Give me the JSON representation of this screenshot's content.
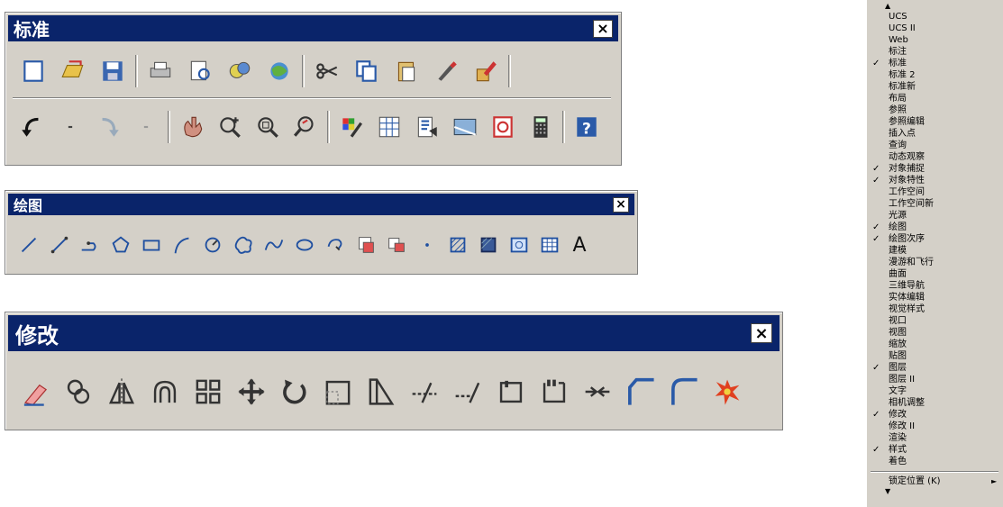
{
  "standard": {
    "title": "标准",
    "close": "×"
  },
  "draw": {
    "title": "绘图",
    "close": "×",
    "text_tool": "A"
  },
  "modify": {
    "title": "修改",
    "close": "×"
  },
  "menu": {
    "scroll_up": "▲",
    "scroll_down": "▼",
    "items": [
      {
        "label": "UCS",
        "checked": false
      },
      {
        "label": "UCS II",
        "checked": false
      },
      {
        "label": "Web",
        "checked": false
      },
      {
        "label": "标注",
        "checked": false
      },
      {
        "label": "标准",
        "checked": true
      },
      {
        "label": "标准 2",
        "checked": false
      },
      {
        "label": "标准新",
        "checked": false
      },
      {
        "label": "布局",
        "checked": false
      },
      {
        "label": "参照",
        "checked": false
      },
      {
        "label": "参照编辑",
        "checked": false
      },
      {
        "label": "插入点",
        "checked": false
      },
      {
        "label": "查询",
        "checked": false
      },
      {
        "label": "动态观察",
        "checked": false
      },
      {
        "label": "对象捕捉",
        "checked": true
      },
      {
        "label": "对象特性",
        "checked": true
      },
      {
        "label": "工作空间",
        "checked": false
      },
      {
        "label": "工作空间新",
        "checked": false
      },
      {
        "label": "光源",
        "checked": false
      },
      {
        "label": "绘图",
        "checked": true
      },
      {
        "label": "绘图次序",
        "checked": true
      },
      {
        "label": "建模",
        "checked": false
      },
      {
        "label": "漫游和飞行",
        "checked": false
      },
      {
        "label": "曲面",
        "checked": false
      },
      {
        "label": "三维导航",
        "checked": false
      },
      {
        "label": "实体编辑",
        "checked": false
      },
      {
        "label": "视觉样式",
        "checked": false
      },
      {
        "label": "视口",
        "checked": false
      },
      {
        "label": "视图",
        "checked": false
      },
      {
        "label": "缩放",
        "checked": false
      },
      {
        "label": "贴图",
        "checked": false
      },
      {
        "label": "图层",
        "checked": true
      },
      {
        "label": "图层 II",
        "checked": false
      },
      {
        "label": "文字",
        "checked": false
      },
      {
        "label": "相机调整",
        "checked": false
      },
      {
        "label": "修改",
        "checked": true
      },
      {
        "label": "修改 II",
        "checked": false
      },
      {
        "label": "渲染",
        "checked": false
      },
      {
        "label": "样式",
        "checked": true
      },
      {
        "label": "着色",
        "checked": false
      }
    ],
    "lock_label": "锁定位置 (K)",
    "checkmark": "✓",
    "submenu_arrow": "►"
  },
  "icons": {
    "standard_row1": [
      "new-icon",
      "open-icon",
      "save-icon",
      "plot-icon",
      "plot-preview-icon",
      "publish-icon",
      "web-publish-icon",
      "cut-icon",
      "copy-icon",
      "paste-icon",
      "match-properties-icon",
      "block-editor-icon"
    ],
    "standard_row2": [
      "undo-icon",
      "undo-dropdown-icon",
      "redo-icon",
      "redo-dropdown-icon",
      "pan-icon",
      "zoom-realtime-icon",
      "zoom-window-icon",
      "zoom-previous-icon",
      "properties-icon",
      "design-center-icon",
      "tool-palettes-icon",
      "sheet-set-icon",
      "markup-icon",
      "calculator-icon",
      "help-icon"
    ],
    "draw": [
      "line-icon",
      "construction-line-icon",
      "polyline-icon",
      "polygon-icon",
      "rectangle-icon",
      "arc-icon",
      "circle-icon",
      "revision-cloud-icon",
      "spline-icon",
      "ellipse-icon",
      "ellipse-arc-icon",
      "insert-block-icon",
      "make-block-icon",
      "point-icon",
      "hatch-icon",
      "gradient-icon",
      "region-icon",
      "table-icon",
      "multiline-text-icon"
    ],
    "modify": [
      "erase-icon",
      "copy-object-icon",
      "mirror-icon",
      "offset-icon",
      "array-icon",
      "move-icon",
      "rotate-icon",
      "scale-icon",
      "stretch-icon",
      "trim-icon",
      "extend-icon",
      "break-at-point-icon",
      "break-icon",
      "join-icon",
      "chamfer-icon",
      "fillet-icon",
      "explode-icon"
    ]
  },
  "colors": {
    "titlebar": "#0a246a",
    "face": "#d4d0c8",
    "icon_blue": "#1f4fa0"
  }
}
